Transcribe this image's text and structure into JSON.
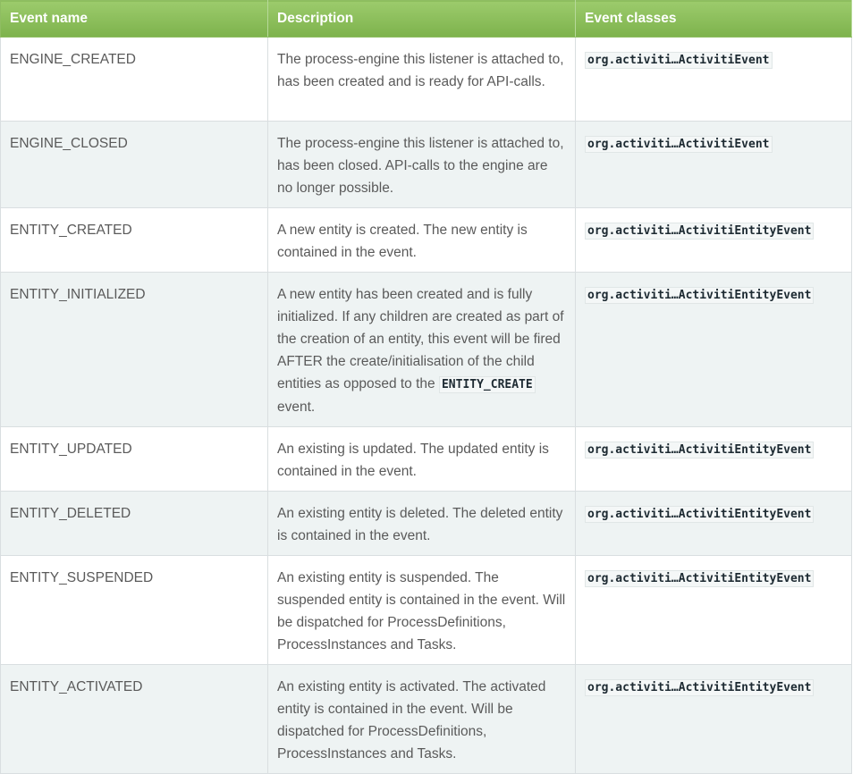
{
  "headers": {
    "event_name": "Event name",
    "description": "Description",
    "event_classes": "Event classes"
  },
  "rows": [
    {
      "name": "ENGINE_CREATED",
      "description": "The process-engine this listener is attached to, has been created and is ready for API-calls.",
      "event_class": "org.activiti…ActivitiEvent"
    },
    {
      "name": "ENGINE_CLOSED",
      "description": "The process-engine this listener is attached to, has been closed. API-calls to the engine are no longer possible.",
      "event_class": "org.activiti…ActivitiEvent"
    },
    {
      "name": "ENTITY_CREATED",
      "description": "A new entity is created. The new entity is contained in the event.",
      "event_class": "org.activiti…ActivitiEntityEvent"
    },
    {
      "name": "ENTITY_INITIALIZED",
      "description": "A new entity has been created and is fully initialized. If any children are created as part of the creation of an entity, this event will be fired AFTER the create/initialisation of the child entities as opposed to the",
      "description_code": "ENTITY_CREATE",
      "description_suffix": " event.",
      "event_class": "org.activiti…ActivitiEntityEvent"
    },
    {
      "name": "ENTITY_UPDATED",
      "description": "An existing is updated. The updated entity is contained in the event.",
      "event_class": "org.activiti…ActivitiEntityEvent"
    },
    {
      "name": "ENTITY_DELETED",
      "description": "An existing entity is deleted. The deleted entity is contained in the event.",
      "event_class": "org.activiti…ActivitiEntityEvent"
    },
    {
      "name": "ENTITY_SUSPENDED",
      "description": "An existing entity is suspended. The suspended entity is contained in the event. Will be dispatched for ProcessDefinitions, ProcessInstances and Tasks.",
      "event_class": "org.activiti…ActivitiEntityEvent"
    },
    {
      "name": "ENTITY_ACTIVATED",
      "description": "An existing entity is activated. The activated entity is contained in the event. Will be dispatched for ProcessDefinitions, ProcessInstances and Tasks.",
      "event_class": "org.activiti…ActivitiEntityEvent"
    }
  ]
}
